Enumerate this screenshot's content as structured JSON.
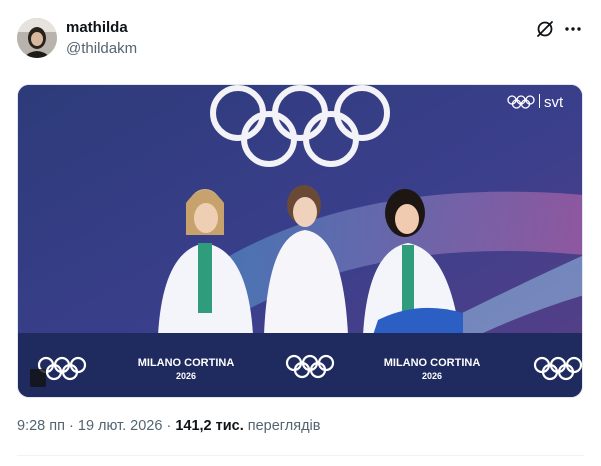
{
  "author": {
    "name": "mathilda",
    "handle": "@thildakm"
  },
  "media": {
    "broadcaster_logo": "svt",
    "banner_text": "MILANO CORTINA",
    "banner_year": "2026"
  },
  "meta": {
    "time": "9:28 пп",
    "date": "19 лют. 2026",
    "separator": "·",
    "views_count": "141,2 тис.",
    "views_label": "переглядів"
  },
  "icons": {
    "grok": "grok-slash-icon",
    "more": "more-dots-icon"
  },
  "colors": {
    "text_primary": "#0f1419",
    "text_secondary": "#536471",
    "banner_navy": "#1f2a5e"
  }
}
